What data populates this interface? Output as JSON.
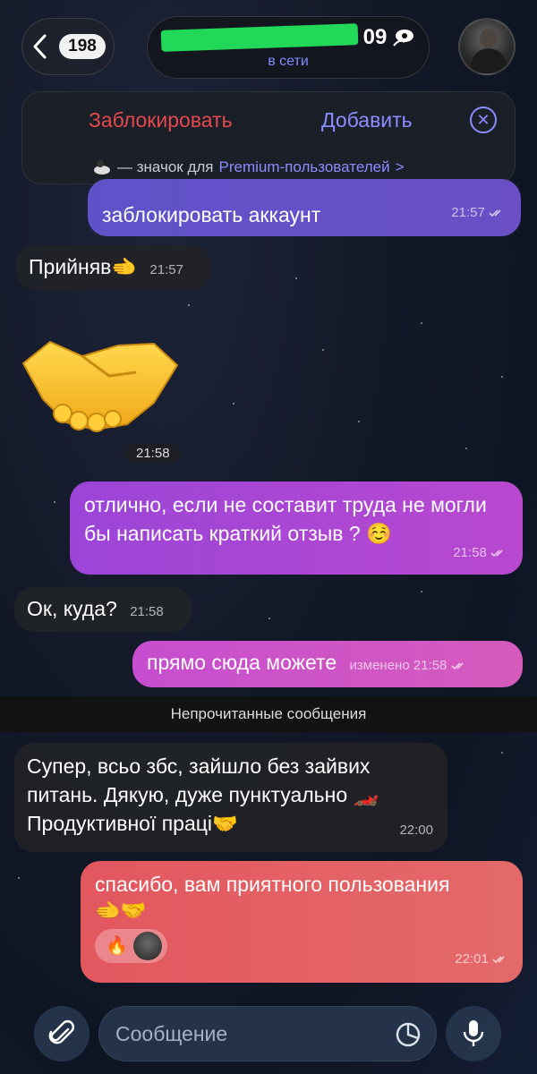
{
  "header": {
    "unread_count": "198",
    "title_suffix": "09",
    "status": "в сети"
  },
  "actions": {
    "block_label": "Заблокировать",
    "add_label": "Добавить",
    "premium_prefix": "— значок для",
    "premium_link": "Premium-пользователей",
    "premium_chevron": ">"
  },
  "messages": [
    {
      "id": "m1",
      "direction": "out",
      "text": "заблокировать аккаунт",
      "time": "21:57"
    },
    {
      "id": "m2",
      "direction": "in",
      "text": "Прийняв🫲",
      "time": "21:57"
    },
    {
      "id": "m3",
      "direction": "in",
      "type": "sticker",
      "sticker": "handshake",
      "time": "21:58"
    },
    {
      "id": "m4",
      "direction": "out",
      "text": "отлично, если не составит труда не могли бы написать краткий отзыв ? ☺️",
      "time": "21:58"
    },
    {
      "id": "m5",
      "direction": "in",
      "text": "Ок, куда?",
      "time": "21:58"
    },
    {
      "id": "m6",
      "direction": "out",
      "text": "прямо сюда можете",
      "edited": "изменено",
      "time": "21:58"
    },
    {
      "id": "m7",
      "direction": "in",
      "text_lines": [
        "Супер, всьо збс, зайшло без зайвих",
        "питань. Дякую, дуже пунктуально 🏎️",
        "Продуктивної праці🤝"
      ],
      "time": "22:00"
    },
    {
      "id": "m8",
      "direction": "out",
      "text_lines": [
        "спасибо, вам приятного пользования",
        "🫲🤝"
      ],
      "reaction": "🔥",
      "time": "22:01"
    }
  ],
  "divider": {
    "label": "Непрочитанные сообщения"
  },
  "composer": {
    "placeholder": "Сообщение"
  },
  "colors": {
    "accent": "#8a8dff",
    "danger": "#e5484d",
    "status_censor": "#22d858"
  }
}
